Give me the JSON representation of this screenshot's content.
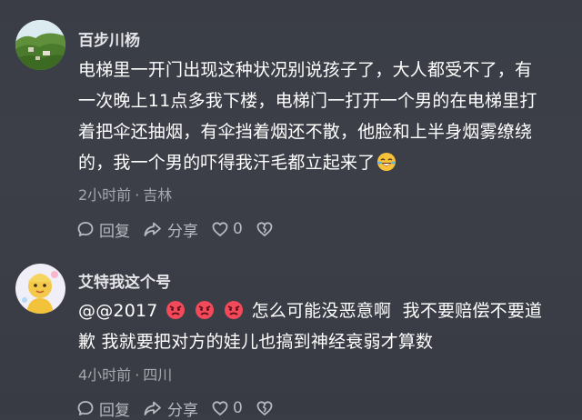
{
  "comments": [
    {
      "username": "百步川杨",
      "lines": [
        "电梯里一开门出现这种状况别说孩子了，大人都受不了，有",
        "一次晚上11点多我下楼，电梯门一打开一个男的在电梯里打",
        "着把伞还抽烟，有伞挡着烟还不散，他脸和上半身烟雾缭绕",
        "的，我一个男的吓得我汗毛都立起来了"
      ],
      "emoji": "laughing-crying-emoji",
      "time": "2小时前",
      "separator": "·",
      "location": "吉林",
      "reply_label": "回复",
      "share_label": "分享",
      "like_count": "0"
    },
    {
      "username": "艾特我这个号",
      "line1_prefix": "@@2017",
      "emojis": [
        "angry-face-emoji",
        "angry-face-emoji",
        "angry-face-emoji"
      ],
      "line1_suffix": "怎么可能没恶意啊  我不要赔偿不要道",
      "line2": "歉 我就要把对方的娃儿也搞到神经衰弱才算数",
      "time": "4小时前",
      "separator": "·",
      "location": "四川",
      "reply_label": "回复",
      "share_label": "分享",
      "like_count": "0"
    }
  ],
  "colors": {
    "background": "#3b3e47",
    "text": "#ffffff",
    "meta": "#a5a7ae",
    "action": "#b8bac1"
  },
  "icons": [
    "comment-bubble-icon",
    "share-arrow-icon",
    "heart-icon",
    "dislike-heart-icon"
  ]
}
